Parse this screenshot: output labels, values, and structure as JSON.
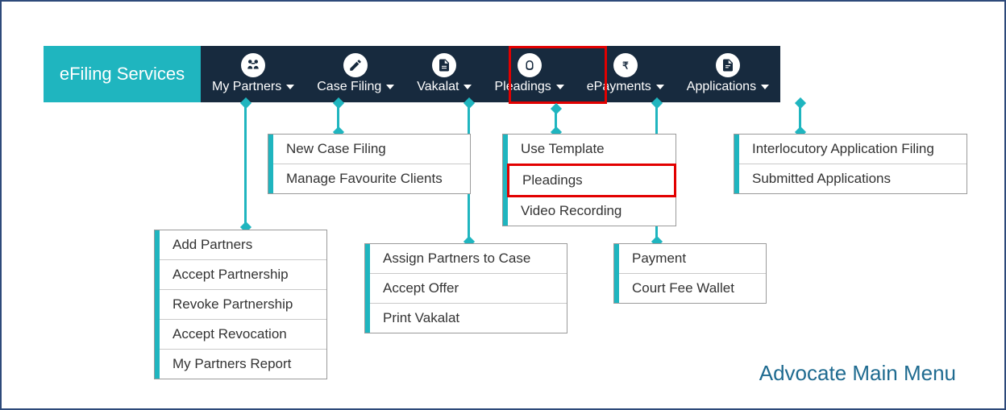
{
  "brand": "eFiling Services",
  "nav": {
    "my_partners": {
      "label": "My Partners",
      "icon": "partners-icon"
    },
    "case_filing": {
      "label": "Case Filing",
      "icon": "pencil-icon"
    },
    "vakalat": {
      "label": "Vakalat",
      "icon": "doc-icon"
    },
    "pleadings": {
      "label": "Pleadings",
      "icon": "hands-icon"
    },
    "epayments": {
      "label": "ePayments",
      "icon": "rupee-icon"
    },
    "applications": {
      "label": "Applications",
      "icon": "doc2-icon"
    }
  },
  "menus": {
    "my_partners": {
      "items": [
        "Add Partners",
        "Accept Partnership",
        "Revoke Partnership",
        "Accept Revocation",
        "My Partners Report"
      ]
    },
    "case_filing": {
      "items": [
        "New Case Filing",
        "Manage Favourite Clients"
      ]
    },
    "vakalat": {
      "items": [
        "Assign Partners to Case",
        "Accept Offer",
        "Print Vakalat"
      ]
    },
    "pleadings": {
      "items": [
        "Use Template",
        "Pleadings",
        "Video Recording"
      ],
      "highlightIndex": 1
    },
    "epayments": {
      "items": [
        "Payment",
        "Court Fee Wallet"
      ]
    },
    "applications": {
      "items": [
        "Interlocutory Application Filing",
        "Submitted Applications"
      ]
    }
  },
  "caption": "Advocate Main Menu"
}
